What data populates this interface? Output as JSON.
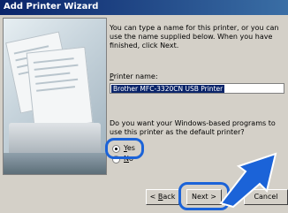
{
  "window": {
    "title": "Add Printer Wizard"
  },
  "content": {
    "description": "You can type a name for this printer, or you can use the name supplied below. When you have finished, click Next.",
    "printer_name_label_underlined": "P",
    "printer_name_label_rest": "rinter name:",
    "printer_name_value": "Brother MFC-3320CN USB Printer",
    "default_question": "Do you want your Windows-based programs to use this printer as the default printer?"
  },
  "options": {
    "yes_underlined": "Y",
    "yes_rest": "es",
    "no_underlined": "N",
    "no_rest": "o",
    "selected": "Yes"
  },
  "buttons": {
    "back_prefix": "< ",
    "back_underlined": "B",
    "back_rest": "ack",
    "next": "Next >",
    "cancel": "Cancel"
  },
  "colors": {
    "highlight": "#1b63d8",
    "titlebar": "#0a246a"
  }
}
